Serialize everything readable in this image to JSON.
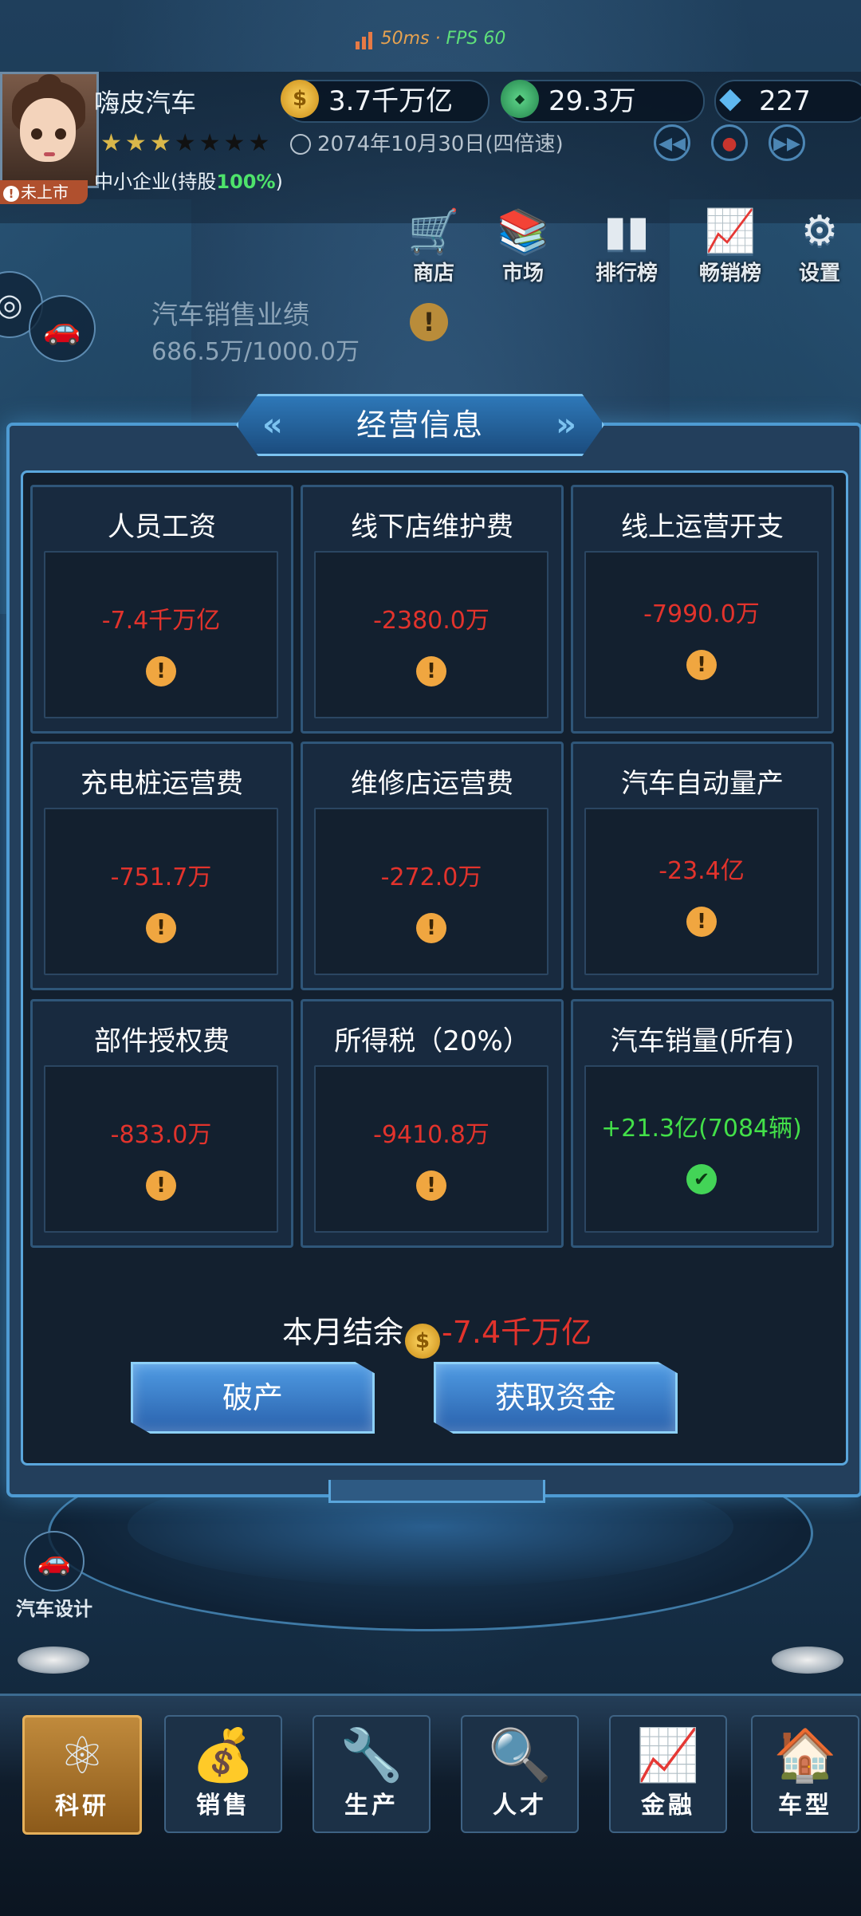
{
  "status": {
    "latency": "50ms",
    "separator": "·",
    "fps": "FPS 60"
  },
  "header": {
    "company_name": "嗨皮汽车",
    "listing_status": "未上市",
    "stars_filled": 3,
    "stars_total": 7,
    "firm_type_prefix": "中小企业(持股",
    "share_pct": "100%",
    "firm_type_suffix": ")",
    "gold": "3.7千万亿",
    "green_currency": "29.3万",
    "gems": "227",
    "date": "2074年10月30日(四倍速)"
  },
  "top_menu": [
    {
      "label": "商店",
      "icon": "cart-icon"
    },
    {
      "label": "市场",
      "icon": "books-icon"
    },
    {
      "label": "排行榜",
      "icon": "bar-chart-icon"
    },
    {
      "label": "畅销榜",
      "icon": "trend-chart-icon"
    },
    {
      "label": "设置",
      "icon": "gear-icon"
    }
  ],
  "task": {
    "title": "汽车销售业绩",
    "progress": "686.5万/1000.0万",
    "progress_fraction": 0.6865
  },
  "dialog": {
    "title": "经营信息",
    "cards": [
      {
        "title": "人员工资",
        "value": "-7.4千万亿",
        "status": "warning"
      },
      {
        "title": "线下店维护费",
        "value": "-2380.0万",
        "status": "warning"
      },
      {
        "title": "线上运营开支",
        "value": "-7990.0万",
        "status": "warning"
      },
      {
        "title": "充电桩运营费",
        "value": "-751.7万",
        "status": "warning"
      },
      {
        "title": "维修店运营费",
        "value": "-272.0万",
        "status": "warning"
      },
      {
        "title": "汽车自动量产",
        "value": "-23.4亿",
        "status": "warning"
      },
      {
        "title": "部件授权费",
        "value": "-833.0万",
        "status": "warning"
      },
      {
        "title": "所得税（20%）",
        "value": "-9410.8万",
        "status": "warning"
      },
      {
        "title": "汽车销量(所有)",
        "value": "+21.3亿(7084辆)",
        "status": "ok"
      }
    ],
    "balance_label": "本月结余",
    "balance_value": "-7.4千万亿",
    "buttons": {
      "bankrupt": "破产",
      "get_funds": "获取资金"
    }
  },
  "side": {
    "car_design": "汽车设计"
  },
  "bottom_nav": [
    {
      "label": "科研",
      "icon": "research-icon",
      "active": true
    },
    {
      "label": "销售",
      "icon": "sales-icon",
      "active": false
    },
    {
      "label": "生产",
      "icon": "tools-icon",
      "active": false
    },
    {
      "label": "人才",
      "icon": "talent-search-icon",
      "active": false
    },
    {
      "label": "金融",
      "icon": "finance-chart-icon",
      "active": false
    },
    {
      "label": "车型",
      "icon": "garage-icon",
      "active": false
    }
  ],
  "colors": {
    "negative": "#e2332c",
    "positive": "#43e049",
    "accent": "#4e9bd3",
    "warning": "#f0a640"
  }
}
